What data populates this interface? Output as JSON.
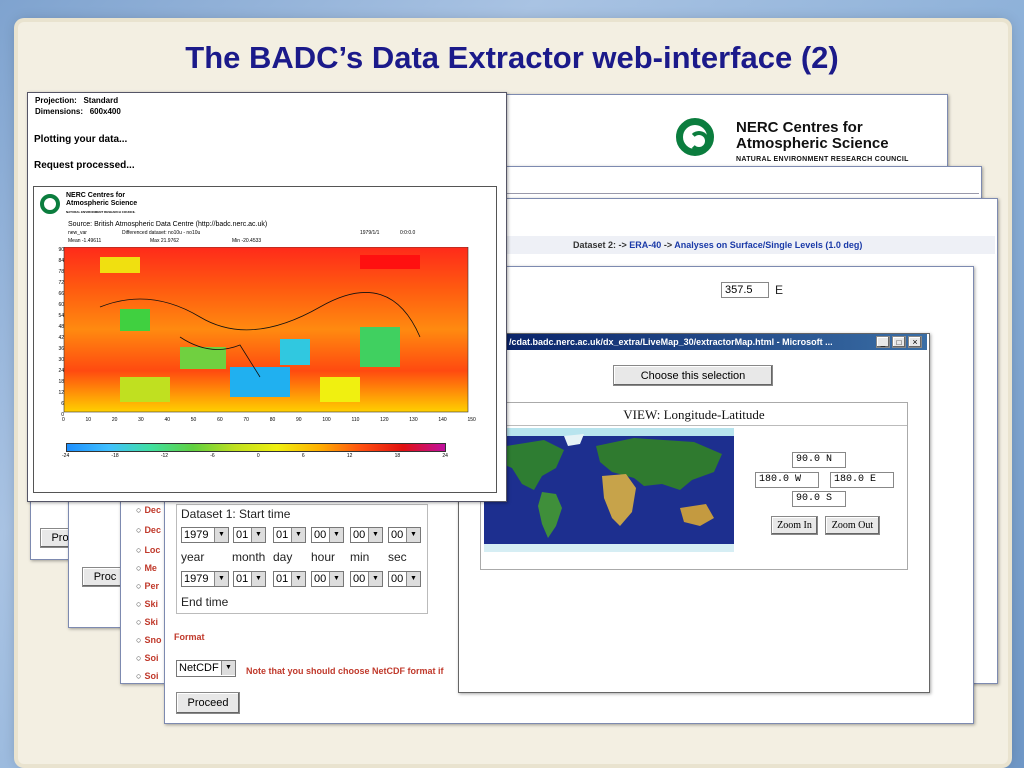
{
  "slide": {
    "title": "The BADC’s Data Extractor web-interface (2)"
  },
  "nerc_logo": {
    "line1": "NERC Centres for",
    "line2": "Atmospheric Science",
    "line3": "NATURAL ENVIRONMENT RESEARCH COUNCIL"
  },
  "dataset_header": {
    "prefix": "Dataset 2: ->",
    "link1": "ERA-40",
    "arrow": "->",
    "link2": "Analyses on Surface/Single Levels (1.0 deg)"
  },
  "coord_field": {
    "value": "357.5",
    "unit": "E"
  },
  "back_buttons": {
    "proceed_left": "Pro",
    "proceed_mid": "Proc",
    "proceed_main": "Proceed"
  },
  "options_list": {
    "items": [
      "Dec",
      "Dec",
      "Loc",
      "Me",
      "Per",
      "Ski",
      "Ski",
      "Sno",
      "Soi",
      "Soi"
    ]
  },
  "time_form": {
    "start_label": "Dataset 1: Start time",
    "end_label": "End time",
    "start_values": [
      "1979",
      "01",
      "01",
      "00",
      "00",
      "00"
    ],
    "end_values": [
      "1979",
      "01",
      "01",
      "00",
      "00",
      "00"
    ],
    "units": [
      "year",
      "month",
      "day",
      "hour",
      "min",
      "sec"
    ]
  },
  "format": {
    "label": "Format",
    "value": "NetCDF",
    "note": "Note that you should choose NetCDF format if"
  },
  "livemap": {
    "title": "/cdat.badc.nerc.ac.uk/dx_extra/LiveMap_30/extractorMap.html - Microsoft ...",
    "choose_button": "Choose this selection",
    "view_title": "VIEW: Longitude-Latitude",
    "north": "90.0 N",
    "west": "180.0 W",
    "east": "180.0 E",
    "south": "90.0 S",
    "zoom_in": "Zoom In",
    "zoom_out": "Zoom Out"
  },
  "plot_window": {
    "projection_label": "Projection:",
    "projection_value": "Standard",
    "dimensions_label": "Dimensions:",
    "dimensions_value": "600x400",
    "status1": "Plotting your data...",
    "status2": "Request processed...",
    "source": "Source: British Atmospheric Data Centre (http://badc.nerc.ac.uk)",
    "var_name": "new_var",
    "diff_label": "Differenced dataset: no10u - no10u",
    "date": "1979/1/1",
    "time": "0:0:0.0",
    "mean": "Mean -1.49611",
    "max": "Max 21.9762",
    "min": "Min -20.4533",
    "y_ticks": [
      "90",
      "84",
      "78",
      "72",
      "66",
      "60",
      "54",
      "48",
      "42",
      "36",
      "30",
      "24",
      "18",
      "12",
      "6",
      "0"
    ],
    "x_ticks": [
      "0",
      "10",
      "20",
      "30",
      "40",
      "50",
      "60",
      "70",
      "80",
      "90",
      "100",
      "110",
      "120",
      "130",
      "140",
      "150"
    ],
    "colorbar_ticks": [
      "-24",
      "-18",
      "-12",
      "-6",
      "0",
      "6",
      "12",
      "18",
      "24"
    ]
  },
  "colors": {
    "title": "#1b1a8a",
    "link": "#1a3aa8",
    "note": "#c0392b",
    "nerc_green": "#0b7d3e"
  }
}
